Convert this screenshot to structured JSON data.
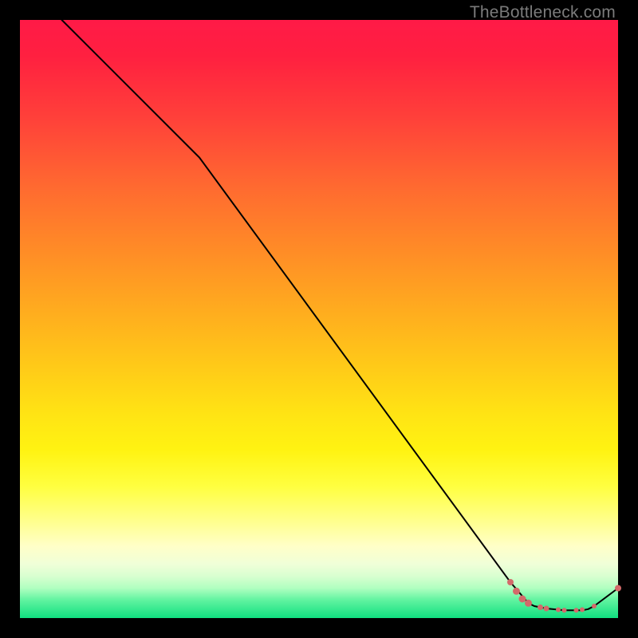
{
  "watermark": "TheBottleneck.com",
  "chart_data": {
    "type": "line",
    "title": "",
    "xlabel": "",
    "ylabel": "",
    "xlim": [
      0,
      100
    ],
    "ylim": [
      0,
      100
    ],
    "grid": false,
    "series": [
      {
        "name": "bottleneck-curve",
        "color": "#000000",
        "x": [
          7,
          30,
          82,
          85,
          86,
          87,
          88,
          89,
          90,
          91,
          92,
          93,
          94,
          95,
          96,
          100
        ],
        "y": [
          100,
          77,
          6,
          2.5,
          2,
          1.8,
          1.6,
          1.5,
          1.4,
          1.3,
          1.3,
          1.3,
          1.3,
          1.5,
          2,
          5
        ]
      }
    ],
    "markers": [
      {
        "x": 82,
        "y": 6.0,
        "r": 4.0,
        "color": "#d36a6a"
      },
      {
        "x": 83,
        "y": 4.5,
        "r": 4.5,
        "color": "#d36a6a"
      },
      {
        "x": 84,
        "y": 3.2,
        "r": 4.5,
        "color": "#d36a6a"
      },
      {
        "x": 85,
        "y": 2.5,
        "r": 4.5,
        "color": "#d36a6a"
      },
      {
        "x": 87,
        "y": 1.8,
        "r": 3.5,
        "color": "#d36a6a"
      },
      {
        "x": 88,
        "y": 1.6,
        "r": 3.5,
        "color": "#d36a6a"
      },
      {
        "x": 90,
        "y": 1.4,
        "r": 3.0,
        "color": "#d36a6a"
      },
      {
        "x": 91,
        "y": 1.3,
        "r": 3.0,
        "color": "#d36a6a"
      },
      {
        "x": 93,
        "y": 1.3,
        "r": 3.0,
        "color": "#d36a6a"
      },
      {
        "x": 94,
        "y": 1.4,
        "r": 3.0,
        "color": "#d36a6a"
      },
      {
        "x": 96,
        "y": 2.0,
        "r": 3.0,
        "color": "#d36a6a"
      },
      {
        "x": 100,
        "y": 5.0,
        "r": 4.0,
        "color": "#d36a6a"
      }
    ]
  }
}
